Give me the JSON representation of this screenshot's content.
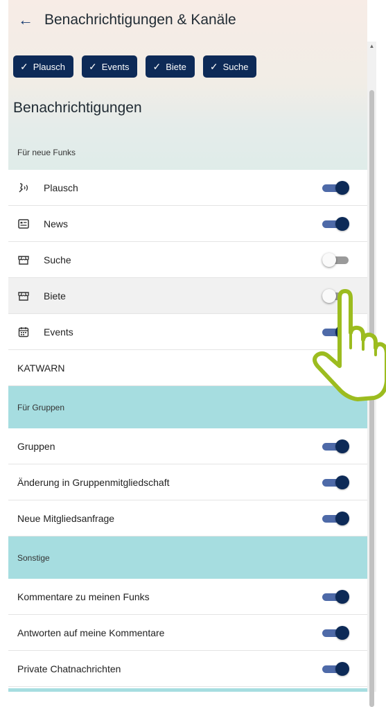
{
  "header": {
    "back_icon": "arrow-left-icon",
    "title": "Benachrichtigungen & Kanäle"
  },
  "chips": [
    {
      "label": "Plausch",
      "icon": "check-icon"
    },
    {
      "label": "Events",
      "icon": "check-icon"
    },
    {
      "label": "Biete",
      "icon": "check-icon"
    },
    {
      "label": "Suche",
      "icon": "check-icon"
    }
  ],
  "section_title": "Benachrichtigungen",
  "groups": {
    "funks": {
      "title": "Für neue Funks",
      "items": [
        {
          "label": "Plausch",
          "icon": "speech-waves-icon",
          "enabled": true
        },
        {
          "label": "News",
          "icon": "newspaper-icon",
          "enabled": true
        },
        {
          "label": "Suche",
          "icon": "storefront-icon",
          "enabled": false
        },
        {
          "label": "Biete",
          "icon": "storefront-icon",
          "enabled": false
        },
        {
          "label": "Events",
          "icon": "calendar-icon",
          "enabled": true
        },
        {
          "label": "KATWARN",
          "enabled": true
        }
      ]
    },
    "gruppen": {
      "title": "Für Gruppen",
      "items": [
        {
          "label": "Gruppen",
          "enabled": true
        },
        {
          "label": "Änderung in Gruppenmitgliedschaft",
          "enabled": true
        },
        {
          "label": "Neue Mitgliedsanfrage",
          "enabled": true
        }
      ]
    },
    "sonstige": {
      "title": "Sonstige",
      "items": [
        {
          "label": "Kommentare zu meinen Funks",
          "enabled": true
        },
        {
          "label": "Antworten auf meine Kommentare",
          "enabled": true
        },
        {
          "label": "Private Chatnachrichten",
          "enabled": true
        }
      ]
    }
  },
  "colors": {
    "primary": "#0d2a57",
    "track_on": "#4e6aa8",
    "section_bg": "#a6dde0",
    "highlight": "#9cbc1f"
  }
}
